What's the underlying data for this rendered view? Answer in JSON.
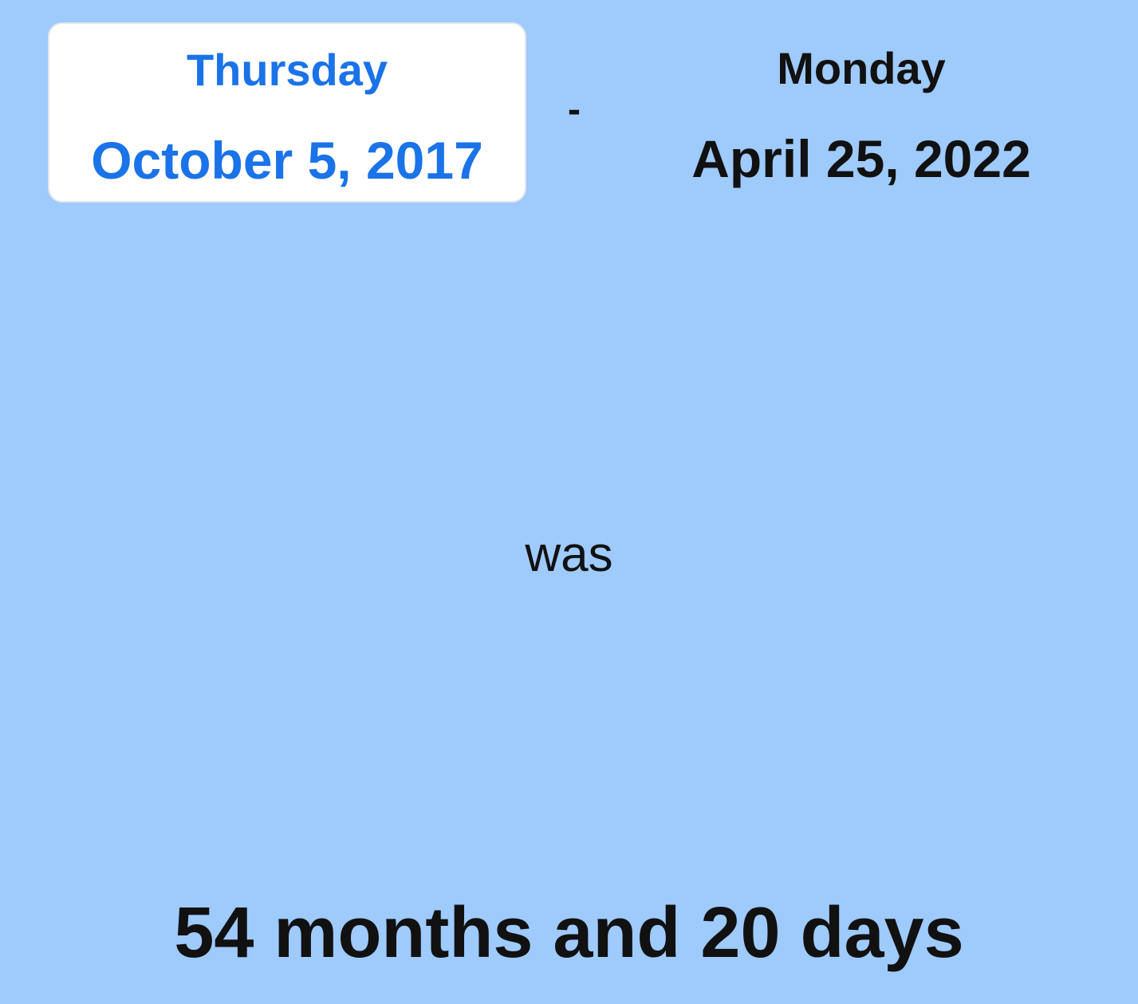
{
  "start_date": {
    "weekday": "Thursday",
    "date": "October 5, 2017"
  },
  "separator": "-",
  "end_date": {
    "weekday": "Monday",
    "date": "April 25, 2022"
  },
  "connector": "was",
  "result": "54 months and 20 days",
  "colors": {
    "background": "#9ecafc",
    "accent": "#1a73e8",
    "text": "#111111",
    "card": "#ffffff"
  }
}
